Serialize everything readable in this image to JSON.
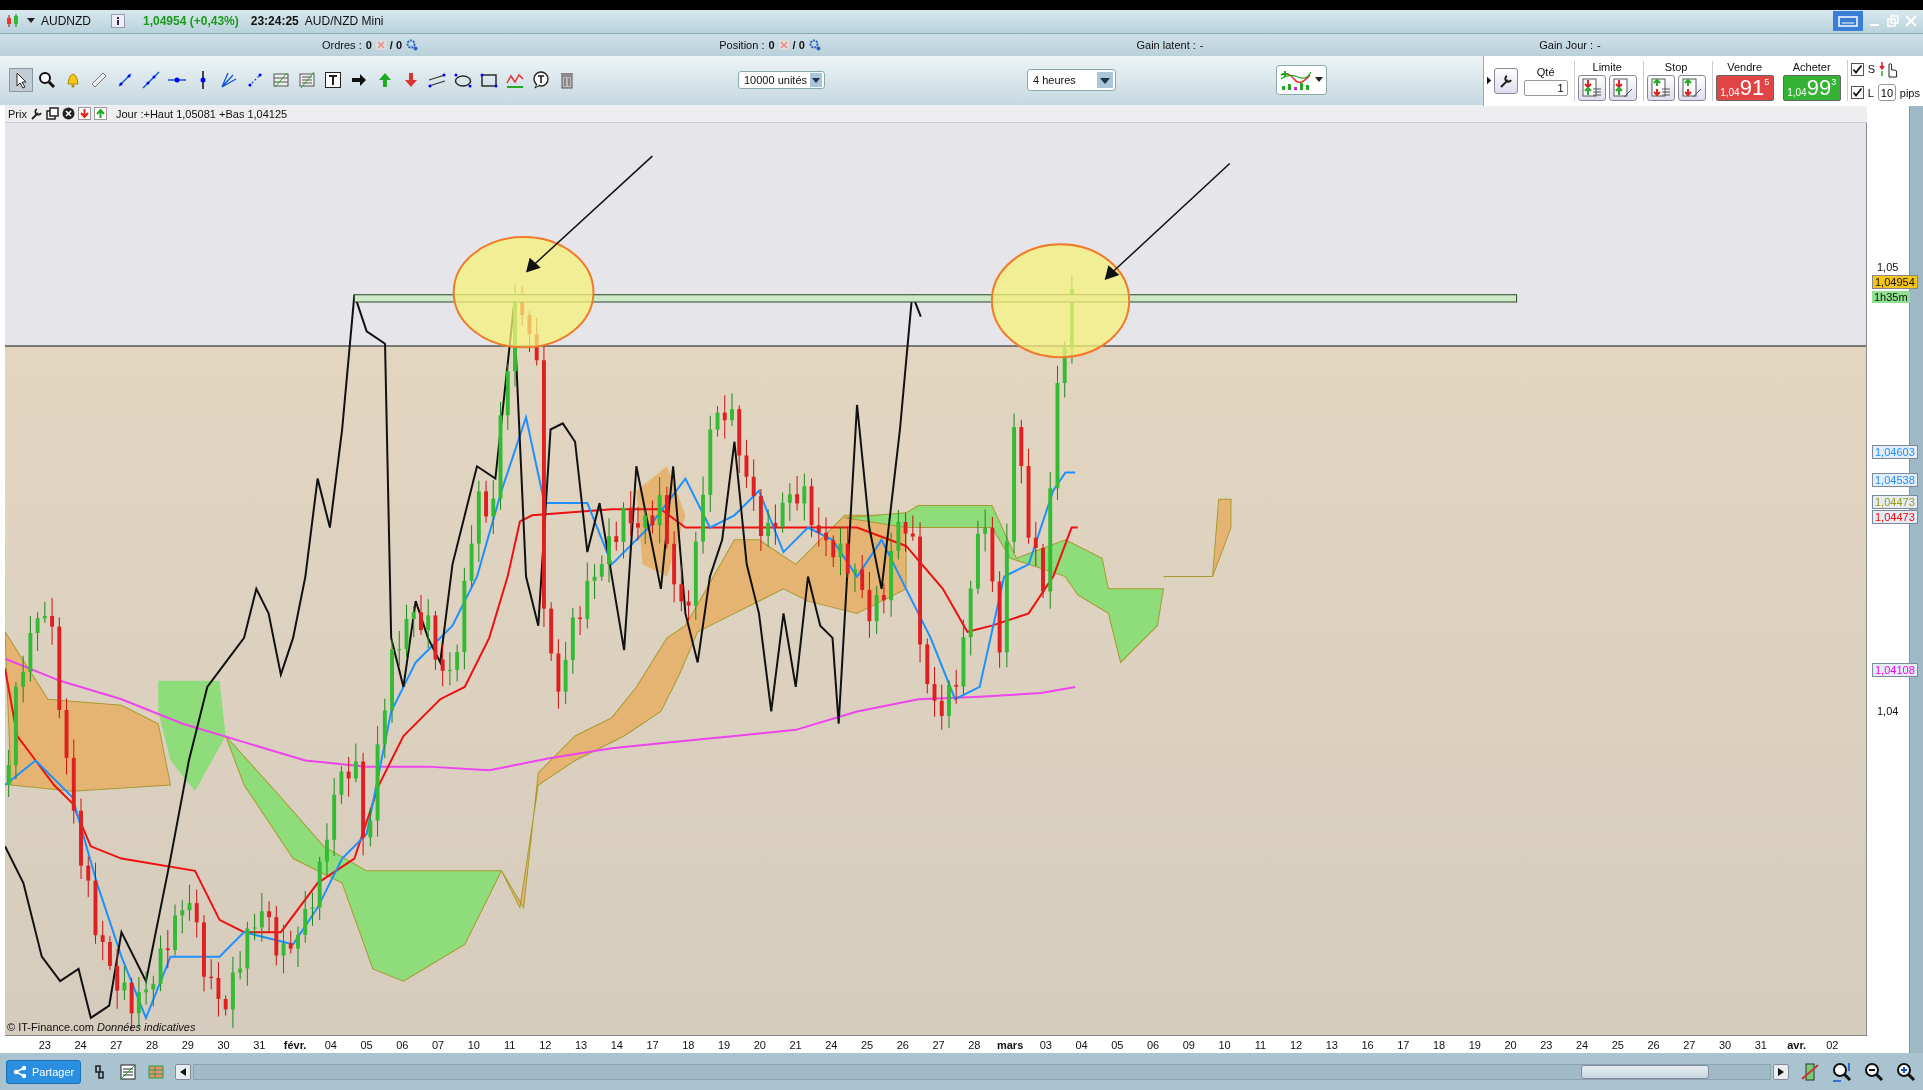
{
  "title_bar": {
    "symbol": "AUDNZD",
    "price_change": "1,04954 (+0,43%)",
    "time": "23:24:25",
    "instrument": "AUD/NZD Mini"
  },
  "info_bar": [
    {
      "label": "Ordres :",
      "count": "0",
      "total": "/ 0",
      "kind": "orders"
    },
    {
      "label": "Position :",
      "count": "0",
      "total": "/ 0",
      "kind": "orders"
    },
    {
      "label": "Gain latent :",
      "value": "-",
      "kind": "gain"
    },
    {
      "label": "Gain Jour :",
      "value": "-",
      "kind": "gain"
    }
  ],
  "toolbar": {
    "tools": [
      {
        "kind": "pointer",
        "selected": true
      },
      {
        "kind": "zoom",
        "selected": false
      },
      {
        "kind": "alert",
        "selected": false
      },
      {
        "kind": "ruler",
        "selected": false
      },
      {
        "kind": "segment",
        "selected": false
      },
      {
        "kind": "line",
        "selected": false
      },
      {
        "kind": "hline",
        "selected": false
      },
      {
        "kind": "vline",
        "selected": false
      },
      {
        "kind": "fan",
        "selected": false
      },
      {
        "kind": "points",
        "selected": false
      },
      {
        "kind": "channel",
        "selected": false
      },
      {
        "kind": "regression",
        "selected": false
      },
      {
        "kind": "text",
        "selected": false
      },
      {
        "kind": "arrow",
        "selected": false
      },
      {
        "kind": "arrow-up",
        "selected": false
      },
      {
        "kind": "arrow-down",
        "selected": false
      },
      {
        "kind": "parallel",
        "selected": false
      },
      {
        "kind": "ellipse",
        "selected": false
      },
      {
        "kind": "rectangle",
        "selected": false
      },
      {
        "kind": "indicator",
        "selected": false
      },
      {
        "kind": "bubble",
        "selected": false
      },
      {
        "kind": "trash",
        "selected": false
      }
    ],
    "units": "10000 unités",
    "period": "4 heures"
  },
  "order_panel": {
    "qty_label": "Qté",
    "qty": "1",
    "limit_label": "Limite",
    "stop_label": "Stop",
    "sell": {
      "label": "Vendre",
      "prefix": "1,04",
      "big": "91",
      "sup": "5"
    },
    "buy": {
      "label": "Acheter",
      "prefix": "1,04",
      "big": "99",
      "sup": "3"
    },
    "checkboxes": [
      {
        "label": "S",
        "checked": true
      },
      {
        "label": "L",
        "checked": true
      }
    ],
    "pips": "10",
    "pips_label": "pips"
  },
  "chart_header": {
    "label": "Prix",
    "info": "Jour :+Haut 1,05081 +Bas 1,04125"
  },
  "price_labels": [
    {
      "text": "1,05",
      "kind": "tick"
    },
    {
      "text": "1,04954",
      "kind": "last"
    },
    {
      "text": "1h35m",
      "kind": "timer"
    },
    {
      "text": "1,04603",
      "kind": "indicator",
      "color": "#1e90ff"
    },
    {
      "text": "1,04538",
      "kind": "indicator",
      "color": "#1e90ff"
    },
    {
      "text": "1,04473",
      "kind": "indicator",
      "color": "#a09a10"
    },
    {
      "text": "1,04473",
      "kind": "indicator",
      "color": "#ff0000"
    },
    {
      "text": "1,04108",
      "kind": "indicator",
      "color": "#ff00ff"
    },
    {
      "text": "1,04",
      "kind": "tick"
    }
  ],
  "copyright": "© IT-Finance.com",
  "disclaimer": "Données indicatives",
  "x_axis": [
    {
      "label": "23",
      "bold": false
    },
    {
      "label": "24",
      "bold": false
    },
    {
      "label": "27",
      "bold": false
    },
    {
      "label": "28",
      "bold": false
    },
    {
      "label": "29",
      "bold": false
    },
    {
      "label": "30",
      "bold": false
    },
    {
      "label": "31",
      "bold": false
    },
    {
      "label": "févr.",
      "bold": true
    },
    {
      "label": "04",
      "bold": false
    },
    {
      "label": "05",
      "bold": false
    },
    {
      "label": "06",
      "bold": false
    },
    {
      "label": "07",
      "bold": false
    },
    {
      "label": "10",
      "bold": false
    },
    {
      "label": "11",
      "bold": false
    },
    {
      "label": "12",
      "bold": false
    },
    {
      "label": "13",
      "bold": false
    },
    {
      "label": "14",
      "bold": false
    },
    {
      "label": "17",
      "bold": false
    },
    {
      "label": "18",
      "bold": false
    },
    {
      "label": "19",
      "bold": false
    },
    {
      "label": "20",
      "bold": false
    },
    {
      "label": "21",
      "bold": false
    },
    {
      "label": "24",
      "bold": false
    },
    {
      "label": "25",
      "bold": false
    },
    {
      "label": "26",
      "bold": false
    },
    {
      "label": "27",
      "bold": false
    },
    {
      "label": "28",
      "bold": false
    },
    {
      "label": "mars",
      "bold": true
    },
    {
      "label": "03",
      "bold": false
    },
    {
      "label": "04",
      "bold": false
    },
    {
      "label": "05",
      "bold": false
    },
    {
      "label": "06",
      "bold": false
    },
    {
      "label": "09",
      "bold": false
    },
    {
      "label": "10",
      "bold": false
    },
    {
      "label": "11",
      "bold": false
    },
    {
      "label": "12",
      "bold": false
    },
    {
      "label": "13",
      "bold": false
    },
    {
      "label": "16",
      "bold": false
    },
    {
      "label": "17",
      "bold": false
    },
    {
      "label": "18",
      "bold": false
    },
    {
      "label": "19",
      "bold": false
    },
    {
      "label": "20",
      "bold": false
    },
    {
      "label": "23",
      "bold": false
    },
    {
      "label": "24",
      "bold": false
    },
    {
      "label": "25",
      "bold": false
    },
    {
      "label": "26",
      "bold": false
    },
    {
      "label": "27",
      "bold": false
    },
    {
      "label": "30",
      "bold": false
    },
    {
      "label": "31",
      "bold": false
    },
    {
      "label": "avr.",
      "bold": true
    },
    {
      "label": "02",
      "bold": false
    }
  ],
  "bottom_bar": {
    "share": "Partager"
  }
}
